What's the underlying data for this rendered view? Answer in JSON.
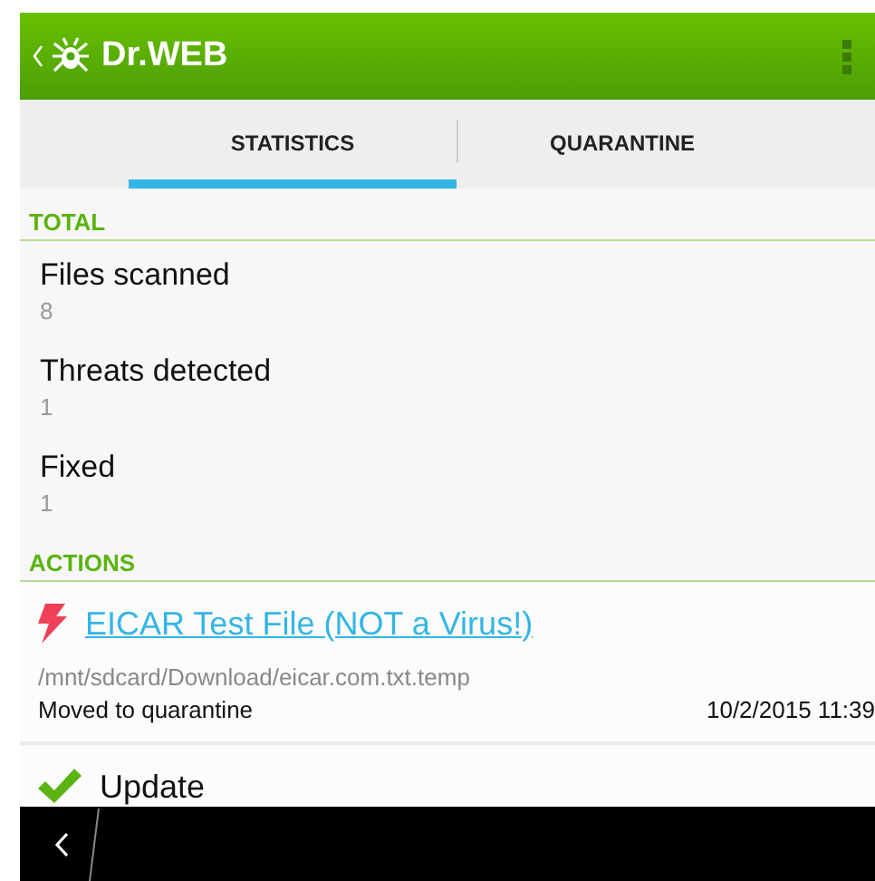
{
  "app_bar": {
    "title": "Dr.WEB"
  },
  "tabs": [
    {
      "label": "STATISTICS",
      "selected": true
    },
    {
      "label": "QUARANTINE",
      "selected": false
    }
  ],
  "sections": [
    {
      "title": "TOTAL",
      "kind": "stats",
      "items": [
        {
          "label": "Files scanned",
          "value": "8"
        },
        {
          "label": "Threats detected",
          "value": "1"
        },
        {
          "label": "Fixed",
          "value": "1"
        }
      ]
    },
    {
      "title": "ACTIONS",
      "kind": "actions",
      "items": [
        {
          "kind": "threat",
          "title": "EICAR Test File (NOT a Virus!)",
          "path": "/mnt/sdcard/Download/eicar.com.txt.temp",
          "status": "Moved to quarantine",
          "time": "10/2/2015 11:39"
        },
        {
          "kind": "update",
          "title": "Update"
        }
      ]
    }
  ]
}
